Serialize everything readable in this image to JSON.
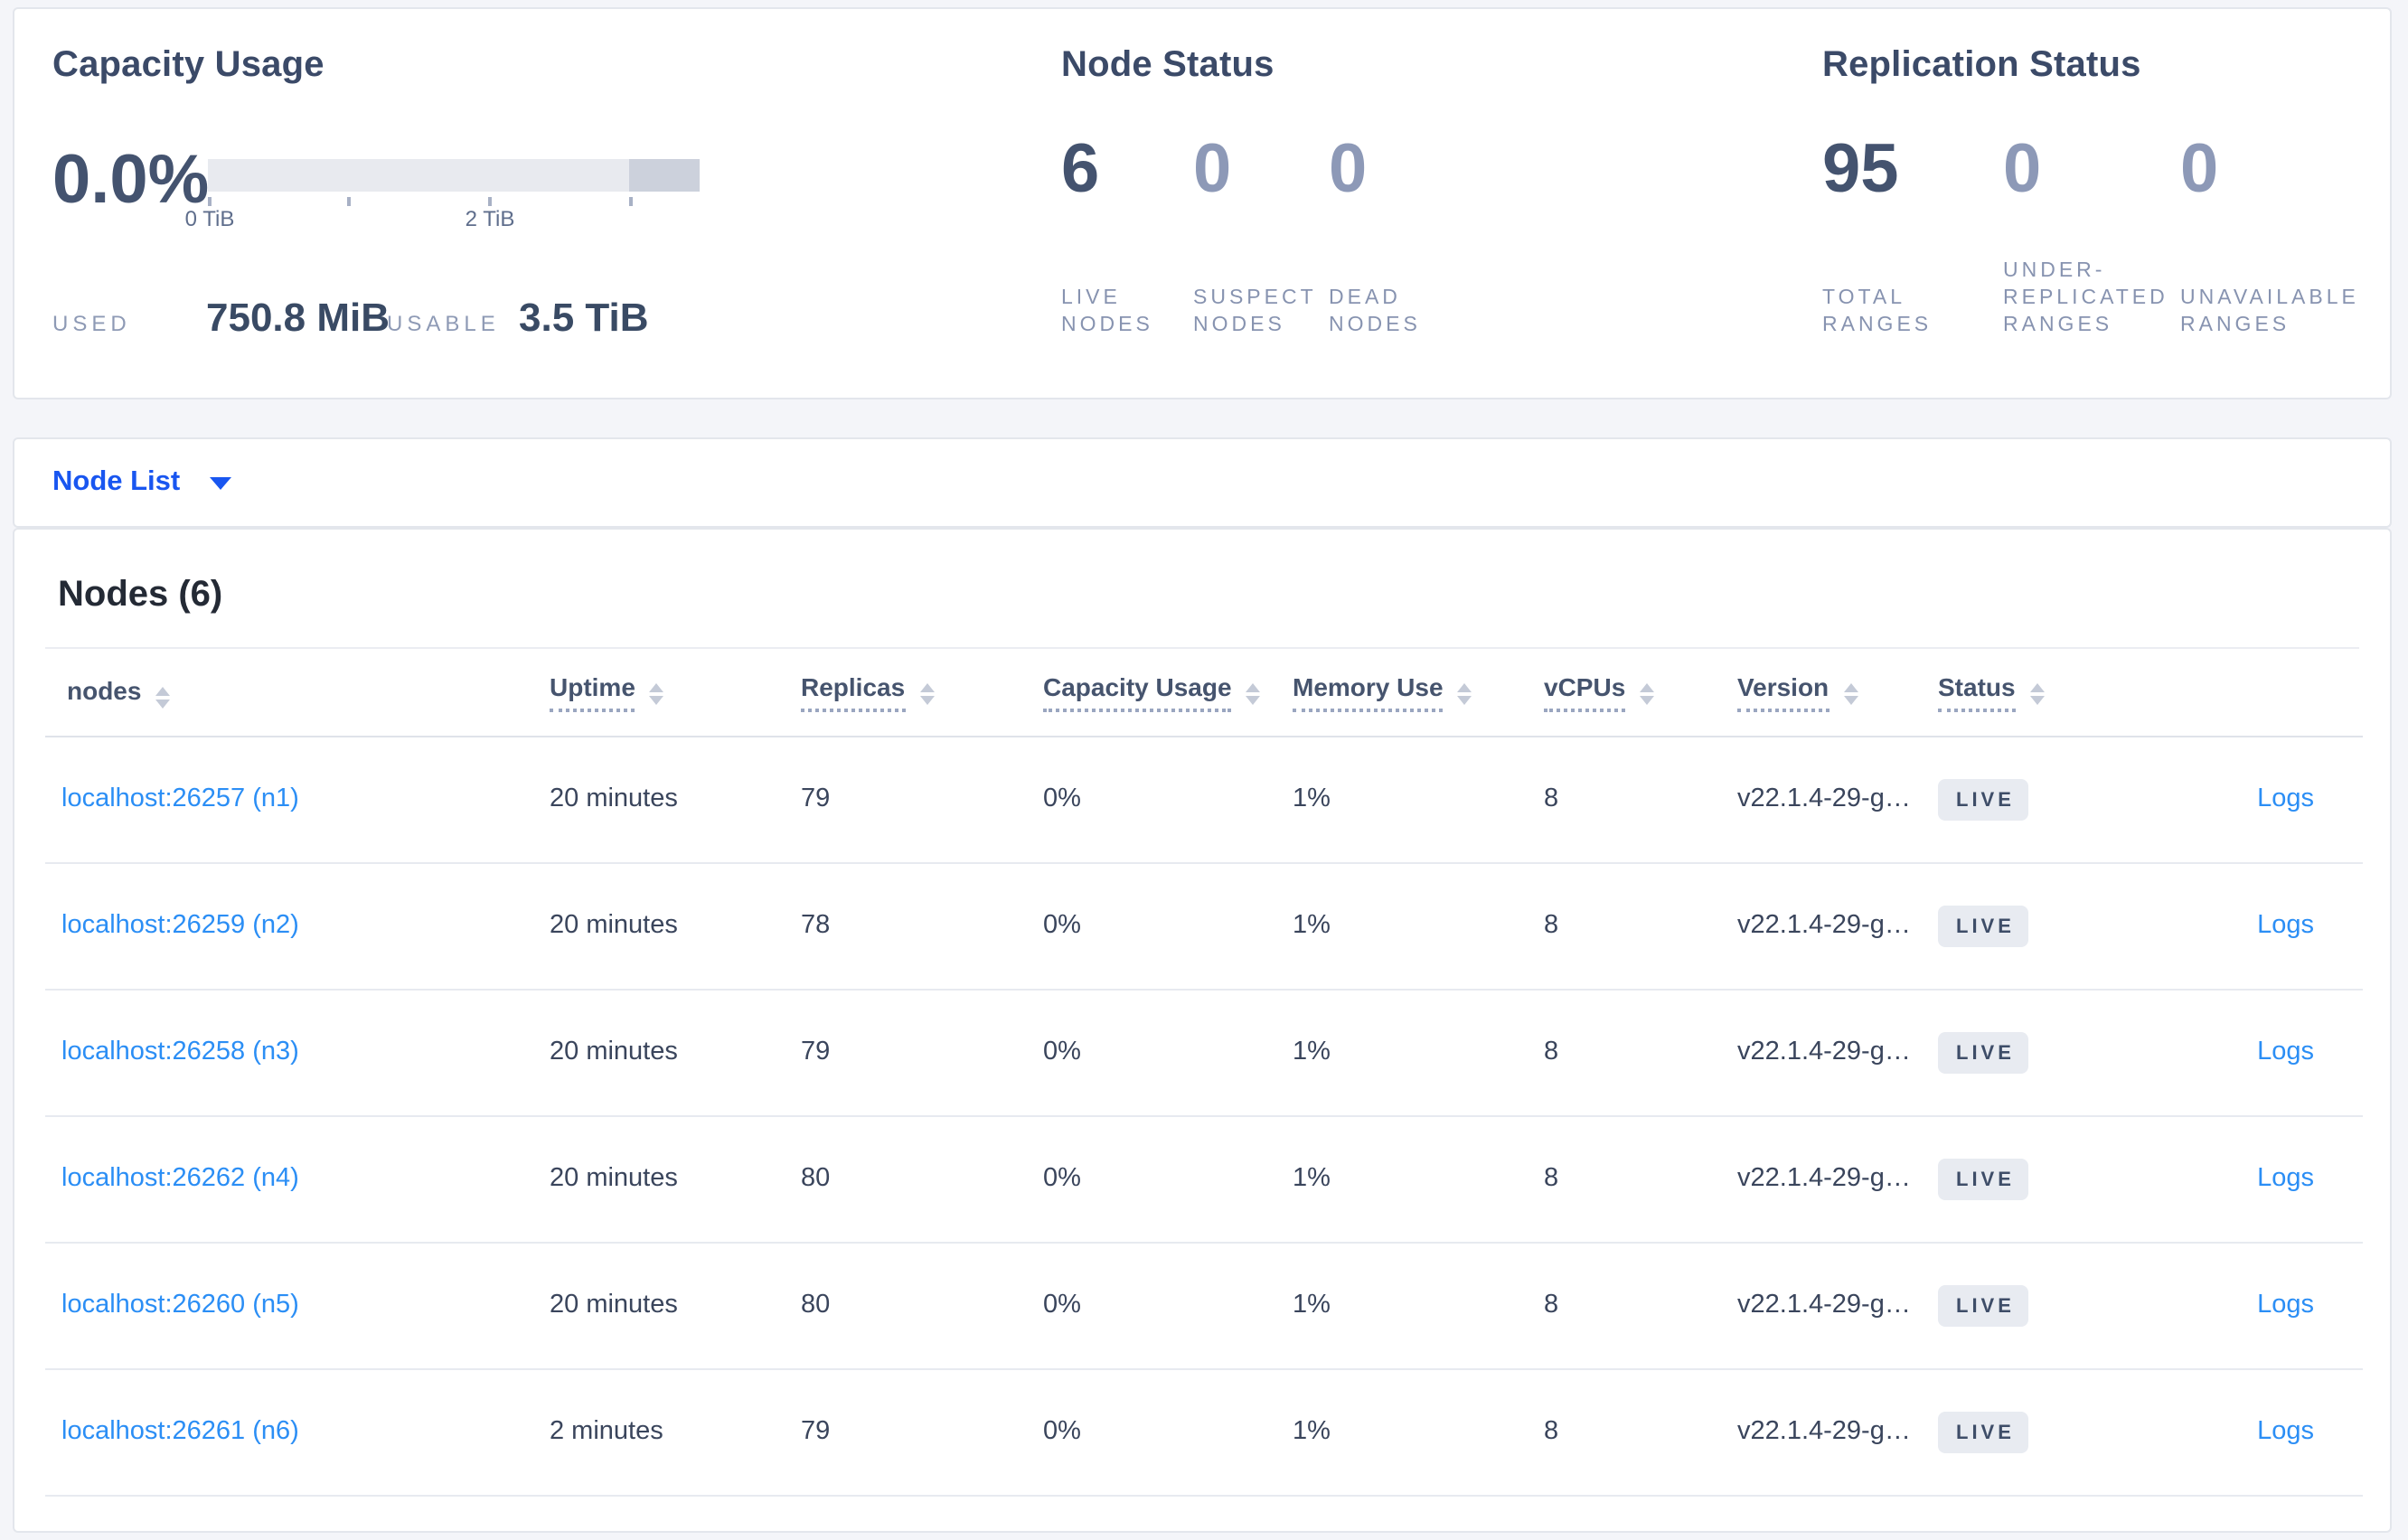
{
  "summary": {
    "capacity": {
      "title": "Capacity Usage",
      "percent": "0.0%",
      "used_label": "USED",
      "used_value": "750.8 MiB",
      "usable_label": "USABLE",
      "usable_value": "3.5 TiB",
      "axis": {
        "tick_labels": [
          "0 TiB",
          "2 TiB"
        ],
        "total_tib": 3.5,
        "tick_positions_tib": [
          0,
          1,
          2,
          3
        ],
        "dark_segment_fraction": 0.143
      }
    },
    "node_status": {
      "title": "Node Status",
      "stats": [
        {
          "value": "6",
          "label": "LIVE NODES"
        },
        {
          "value": "0",
          "label": "SUSPECT NODES"
        },
        {
          "value": "0",
          "label": "DEAD NODES"
        }
      ]
    },
    "replication_status": {
      "title": "Replication Status",
      "stats": [
        {
          "value": "95",
          "label": "TOTAL RANGES"
        },
        {
          "value": "0",
          "label": "UNDER-REPLICATED RANGES"
        },
        {
          "value": "0",
          "label": "UNAVAILABLE RANGES"
        }
      ]
    }
  },
  "view_selector": {
    "label": "Node List",
    "icon": "caret-down-icon"
  },
  "nodes_section": {
    "title": "Nodes (6)",
    "columns": [
      {
        "label": "nodes"
      },
      {
        "label": "Uptime"
      },
      {
        "label": "Replicas"
      },
      {
        "label": "Capacity Usage"
      },
      {
        "label": "Memory Use"
      },
      {
        "label": "vCPUs"
      },
      {
        "label": "Version"
      },
      {
        "label": "Status"
      }
    ],
    "rows": [
      {
        "address": "localhost:26257 (n1)",
        "uptime": "20 minutes",
        "replicas": "79",
        "capacity_usage": "0%",
        "memory_use": "1%",
        "vcpus": "8",
        "version": "v22.1.4-29-g…",
        "status": "LIVE",
        "logs_label": "Logs"
      },
      {
        "address": "localhost:26259 (n2)",
        "uptime": "20 minutes",
        "replicas": "78",
        "capacity_usage": "0%",
        "memory_use": "1%",
        "vcpus": "8",
        "version": "v22.1.4-29-g…",
        "status": "LIVE",
        "logs_label": "Logs"
      },
      {
        "address": "localhost:26258 (n3)",
        "uptime": "20 minutes",
        "replicas": "79",
        "capacity_usage": "0%",
        "memory_use": "1%",
        "vcpus": "8",
        "version": "v22.1.4-29-g…",
        "status": "LIVE",
        "logs_label": "Logs"
      },
      {
        "address": "localhost:26262 (n4)",
        "uptime": "20 minutes",
        "replicas": "80",
        "capacity_usage": "0%",
        "memory_use": "1%",
        "vcpus": "8",
        "version": "v22.1.4-29-g…",
        "status": "LIVE",
        "logs_label": "Logs"
      },
      {
        "address": "localhost:26260 (n5)",
        "uptime": "20 minutes",
        "replicas": "80",
        "capacity_usage": "0%",
        "memory_use": "1%",
        "vcpus": "8",
        "version": "v22.1.4-29-g…",
        "status": "LIVE",
        "logs_label": "Logs"
      },
      {
        "address": "localhost:26261 (n6)",
        "uptime": "2 minutes",
        "replicas": "79",
        "capacity_usage": "0%",
        "memory_use": "1%",
        "vcpus": "8",
        "version": "v22.1.4-29-g…",
        "status": "LIVE",
        "logs_label": "Logs"
      }
    ]
  },
  "icons": {
    "view_caret": "caret-down-icon",
    "column_sort": "sort-arrows-icon"
  },
  "colors": {
    "page_background": "#f4f5f9",
    "panel_border": "#e3e6ec",
    "heading_dark": "#3b4a68",
    "stat_strong": "#44536f",
    "stat_muted": "#8d99b7",
    "caps_label": "#8793b0",
    "bar_light": "#e8eaef",
    "bar_dark": "#ccd1dc",
    "link_blue": "#2b8ef5",
    "selector_blue": "#1956f0",
    "badge_bg": "#e8ebf1",
    "badge_text": "#3e4d68"
  }
}
